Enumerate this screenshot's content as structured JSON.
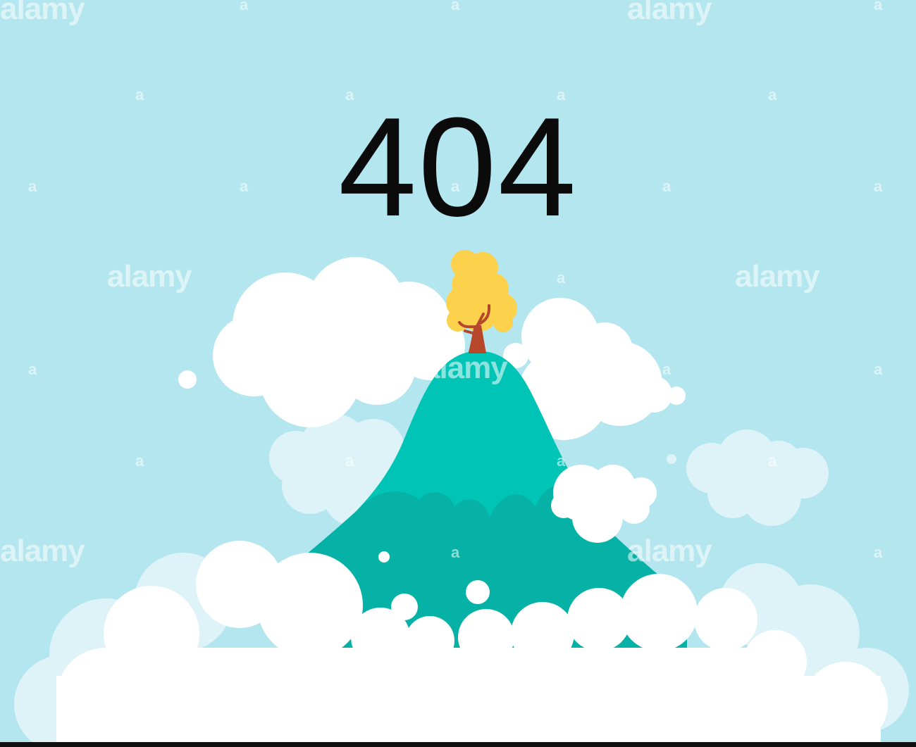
{
  "error": {
    "code": "404"
  },
  "watermark": {
    "brand": "alamy",
    "mark": "a"
  },
  "colors": {
    "sky": "#b3e6ee",
    "mountain": "#00c4b6",
    "mountain_shadow": "#06b2a6",
    "cloud": "#ffffff",
    "cloud_faint": "#def3f7",
    "tree_foliage": "#fcd24d",
    "tree_trunk": "#b7472b",
    "text": "#0b0b0b"
  },
  "icons": [
    "mountain-icon",
    "tree-icon",
    "cloud-icon"
  ]
}
